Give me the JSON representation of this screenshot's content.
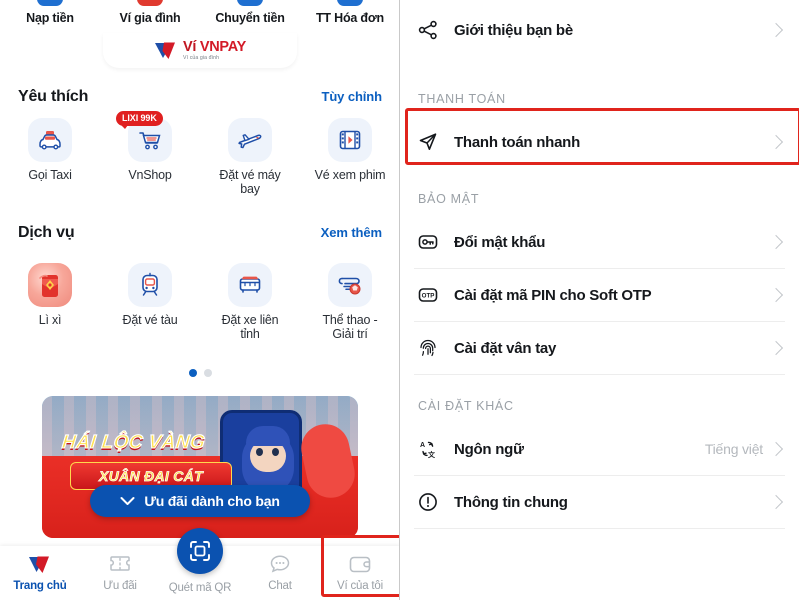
{
  "left": {
    "quick_actions": [
      {
        "label": "Nạp tiền",
        "icon": "wallet-topup-icon",
        "color": "#1f6fd0"
      },
      {
        "label": "Ví gia đình",
        "icon": "family-wallet-icon",
        "color": "#e03a2f"
      },
      {
        "label": "Chuyển tiền",
        "icon": "transfer-icon",
        "color": "#1f6fd0"
      },
      {
        "label": "TT Hóa đơn",
        "icon": "bill-payment-icon",
        "color": "#1f6fd0"
      }
    ],
    "logo": {
      "name": "Ví",
      "brand": "VNPAY",
      "tagline": "Ví của gia đình"
    },
    "favorites": {
      "title": "Yêu thích",
      "action": "Tùy chỉnh",
      "items": [
        {
          "label": "Gọi Taxi",
          "icon": "taxi-icon",
          "badge": ""
        },
        {
          "label": "VnShop",
          "icon": "shopping-cart-icon",
          "badge": "LIXI 99K"
        },
        {
          "label": "Đặt vé máy bay",
          "icon": "airplane-icon",
          "badge": ""
        },
        {
          "label": "Vé xem phim",
          "icon": "movie-ticket-icon",
          "badge": ""
        }
      ]
    },
    "services": {
      "title": "Dịch vụ",
      "action": "Xem thêm",
      "items": [
        {
          "label": "Lì xì",
          "icon": "red-envelope-icon",
          "badge": ""
        },
        {
          "label": "Đặt vé tàu",
          "icon": "train-icon",
          "badge": ""
        },
        {
          "label": "Đặt xe liên tỉnh",
          "icon": "bus-icon",
          "badge": ""
        },
        {
          "label": "Thể thao - Giải trí",
          "icon": "sports-icon",
          "badge": ""
        }
      ]
    },
    "pagination": {
      "total": 2,
      "active": 1
    },
    "banner": {
      "title": "HÁI LỘC VÀNG",
      "subtitle": "XUÂN ĐẠI CÁT",
      "cta": "Ưu đãi dành cho bạn",
      "cta_icon": "chevron-down-icon"
    },
    "bottom_nav": {
      "items": [
        {
          "label": "Trang chủ",
          "icon": "home-vnpay-icon",
          "active": true,
          "highlighted": false
        },
        {
          "label": "Ưu đãi",
          "icon": "voucher-icon",
          "active": false,
          "highlighted": false
        },
        {
          "label": "Quét mã QR",
          "icon": "qr-scan-icon",
          "active": false,
          "highlighted": false
        },
        {
          "label": "Chat",
          "icon": "chat-icon",
          "active": false,
          "highlighted": false
        },
        {
          "label": "Ví của tôi",
          "icon": "wallet-icon",
          "active": false,
          "highlighted": true
        }
      ]
    }
  },
  "right": {
    "top_item": {
      "label": "Giới thiệu bạn bè",
      "icon": "share-nodes-icon"
    },
    "groups": [
      {
        "header": "THANH TOÁN",
        "items": [
          {
            "label": "Thanh toán nhanh",
            "icon": "paper-plane-icon",
            "value": "",
            "highlighted": true
          }
        ]
      },
      {
        "header": "BẢO MẬT",
        "items": [
          {
            "label": "Đổi mật khẩu",
            "icon": "key-icon",
            "value": "",
            "highlighted": false
          },
          {
            "label": "Cài đặt mã PIN cho Soft OTP",
            "icon": "otp-icon",
            "value": "",
            "highlighted": false
          },
          {
            "label": "Cài đặt vân tay",
            "icon": "fingerprint-icon",
            "value": "",
            "highlighted": false
          }
        ]
      },
      {
        "header": "CÀI ĐẶT KHÁC",
        "items": [
          {
            "label": "Ngôn ngữ",
            "icon": "language-icon",
            "value": "Tiếng việt",
            "highlighted": false
          },
          {
            "label": "Thông tin chung",
            "icon": "info-circle-icon",
            "value": "",
            "highlighted": false
          }
        ]
      }
    ]
  },
  "colors": {
    "brand_blue": "#0b52b0",
    "brand_red": "#d31a27",
    "highlight_red": "#e0241c",
    "muted_text": "#9aa0a6"
  }
}
